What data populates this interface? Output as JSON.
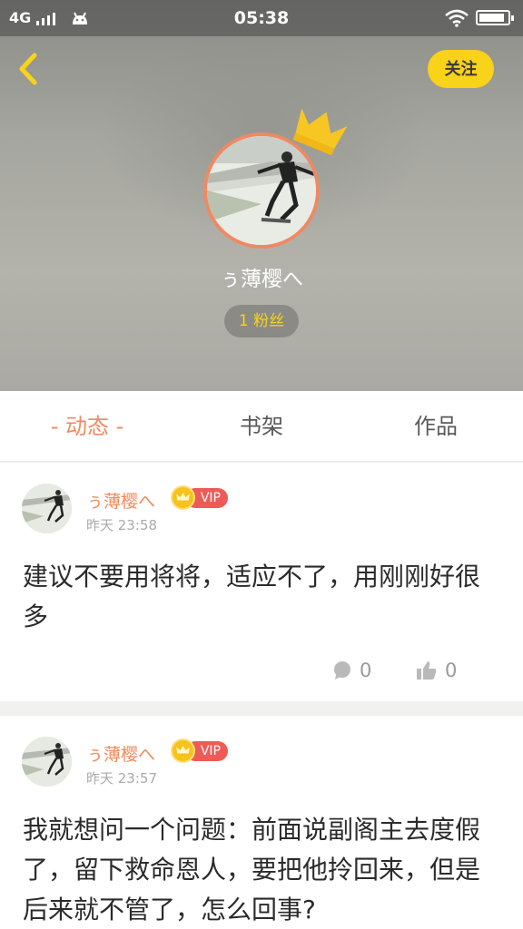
{
  "status_bar": {
    "network": "4G",
    "time": "05:38",
    "battery_level": 0.9
  },
  "header": {
    "follow_label": "关注",
    "profile_name": "ぅ薄樱へ",
    "fans_label": "1 粉丝"
  },
  "tabs": [
    {
      "label": "动态",
      "active": true
    },
    {
      "label": "书架",
      "active": false
    },
    {
      "label": "作品",
      "active": false
    }
  ],
  "posts": [
    {
      "author": "ぅ薄樱へ",
      "badge": "VIP",
      "time": "昨天 23:58",
      "text": "建议不要用将将，适应不了，用刚刚好很多",
      "comments": "0",
      "likes": "0"
    },
    {
      "author": "ぅ薄樱へ",
      "badge": "VIP",
      "time": "昨天 23:57",
      "text": "我就想问一个问题：前面说副阁主去度假了，留下救命恩人，要把他拎回来，但是后来就不管了，怎么回事?"
    }
  ],
  "colors": {
    "accent_orange": "#ef8a5f",
    "accent_yellow": "#f9d21a",
    "vip_red": "#ee5b57"
  },
  "icons": {
    "back": "chevron-left-icon",
    "crown": "crown-icon",
    "comment": "speech-bubble-icon",
    "like": "thumbs-up-icon"
  }
}
